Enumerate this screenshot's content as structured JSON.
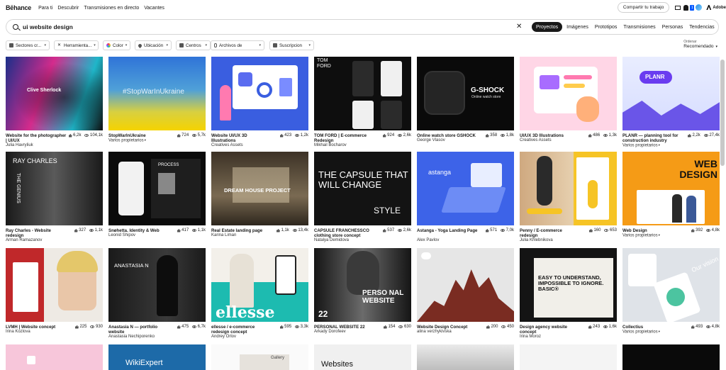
{
  "nav": {
    "logo": "Bēhance",
    "links": [
      "Para ti",
      "Descubrir",
      "Transmisiones en directo",
      "Vacantes"
    ],
    "share_label": "Compartir tu trabajo",
    "notification_count": "1",
    "adobe_label": "Adobe"
  },
  "search": {
    "value": "ui website design",
    "tabs": [
      "Proyectos",
      "Imágenes",
      "Prototipos",
      "Transmisiones",
      "Personas",
      "Tendencias"
    ],
    "active_tab": "Proyectos"
  },
  "filters": [
    {
      "label": "Sectores cr...",
      "icon": "grid-icon"
    },
    {
      "label": "Herramienta...",
      "icon": "tools-icon"
    },
    {
      "label": "Color",
      "icon": "color-wheel-icon"
    },
    {
      "label": "Ubicación",
      "icon": "location-pin-icon"
    },
    {
      "label": "Centros",
      "icon": "school-icon"
    },
    {
      "label": "Archivos de",
      "icon": "paperclip-icon"
    },
    {
      "label": "Suscripcion",
      "icon": "subscription-icon"
    }
  ],
  "sort": {
    "label": "Ordenar",
    "value": "Recomendado"
  },
  "colors": {
    "accent": "#0057ff",
    "text": "#191919",
    "border": "#d6d6d6"
  },
  "projects": [
    {
      "title": "Website for the photographer | UI/UX",
      "owner": "Julia Havryliuk",
      "likes": "6,2k",
      "views": "104,1k",
      "thumb_text": "Clive Sherlock"
    },
    {
      "title": "StopWarInUkraine",
      "owner": "Varios propietarios",
      "likes": "724",
      "views": "5,7k",
      "thumb_text": "#StopWarInUkraine"
    },
    {
      "title": "Website UI/UX 3D Illustrations",
      "owner": "Creatives Assets",
      "likes": "423",
      "views": "1,2k",
      "thumb_text": ""
    },
    {
      "title": "TOM FORD | E-commerce Redesign",
      "owner": "Mikhail Bocharov",
      "likes": "924",
      "views": "2,6k",
      "thumb_text": "TOM FORD"
    },
    {
      "title": "Online watch store GSHOCK",
      "owner": "George Vlasov",
      "likes": "358",
      "views": "1,8k",
      "thumb_text": "G-SHOCK",
      "thumb_sub": "Online watch store"
    },
    {
      "title": "UI/UX 3D Illustrations",
      "owner": "Creatives Assets",
      "likes": "486",
      "views": "1,3k",
      "thumb_text": ""
    },
    {
      "title": "PLANR — planning tool for construction industry",
      "owner": "Varios propietarios",
      "likes": "2,2k",
      "views": "27,4k",
      "thumb_text": "PLANR"
    },
    {
      "title": "Ray Charles - Website redesign",
      "owner": "Arman Ramazanov",
      "likes": "327",
      "views": "1,1k",
      "thumb_text": "RAY CHARLES",
      "thumb_sub": "THE GENIUS"
    },
    {
      "title": "Snøhetta. Identity & Web",
      "owner": "Leonid Shipov",
      "likes": "417",
      "views": "1,1k",
      "thumb_text": "PROCESS"
    },
    {
      "title": "Real Estate landing page",
      "owner": "Karina Liman",
      "likes": "1,1k",
      "views": "13,4k",
      "thumb_text": "DREAM HOUSE PROJECT"
    },
    {
      "title": "CAPSULE FRANCHESSCO clothing store concept",
      "owner": "Natalya Demidova",
      "likes": "537",
      "views": "2,6k",
      "thumb_text": "THE CAPSULE THAT WILL CHANGE",
      "thumb_sub": "STYLE"
    },
    {
      "title": "Astanga - Yoga Landing Page",
      "owner": "Alex Pavlov",
      "likes": "571",
      "views": "7,0k",
      "thumb_text": "astanga"
    },
    {
      "title": "Penny / E-commerce redesign",
      "owner": "Julia Khlebnikova",
      "likes": "160",
      "views": "653",
      "thumb_text": ""
    },
    {
      "title": "Web Design",
      "owner": "Varios propietarios",
      "likes": "392",
      "views": "4,8k",
      "thumb_text": "WEB DESIGN"
    },
    {
      "title": "LVMH | Website concept",
      "owner": "Irina Kozlova",
      "likes": "225",
      "views": "930",
      "thumb_text": ""
    },
    {
      "title": "Anastasia N — portfolio website",
      "owner": "Anastasia Nechiporenko",
      "likes": "475",
      "views": "6,7k",
      "thumb_text": "ANASTASIA N"
    },
    {
      "title": "ellesse / e-commerce redesign concept",
      "owner": "Andrey Orlov",
      "likes": "595",
      "views": "3,3k",
      "thumb_text": "ellesse"
    },
    {
      "title": "PERSONAL WEBSITE 22",
      "owner": "Arkady Dorofeev",
      "likes": "154",
      "views": "630",
      "thumb_text": "PERSO NAL WEBSITE",
      "thumb_sub": "22"
    },
    {
      "title": "Website Design Concept",
      "owner": "alina verzhykivska",
      "likes": "200",
      "views": "450",
      "thumb_text": ""
    },
    {
      "title": "Design agency website concept",
      "owner": "Irina Moroz",
      "likes": "243",
      "views": "1,6k",
      "thumb_text": "EASY TO UNDERSTAND, IMPOSSIBLE TO IGNORE. BASIC®"
    },
    {
      "title": "Collectius",
      "owner": "Varios propietarios",
      "likes": "493",
      "views": "4,8k",
      "thumb_text": "Our vision"
    },
    {
      "title": "",
      "owner": "",
      "likes": "",
      "views": "",
      "thumb_text": ""
    },
    {
      "title": "",
      "owner": "",
      "likes": "",
      "views": "",
      "thumb_text": "WikiExpert"
    },
    {
      "title": "",
      "owner": "",
      "likes": "",
      "views": "",
      "thumb_text": "Gallery"
    },
    {
      "title": "",
      "owner": "",
      "likes": "",
      "views": "",
      "thumb_text": "Websites"
    },
    {
      "title": "",
      "owner": "",
      "likes": "",
      "views": "",
      "thumb_text": ""
    },
    {
      "title": "",
      "owner": "",
      "likes": "",
      "views": "",
      "thumb_text": ""
    },
    {
      "title": "",
      "owner": "",
      "likes": "",
      "views": "",
      "thumb_text": ""
    }
  ]
}
